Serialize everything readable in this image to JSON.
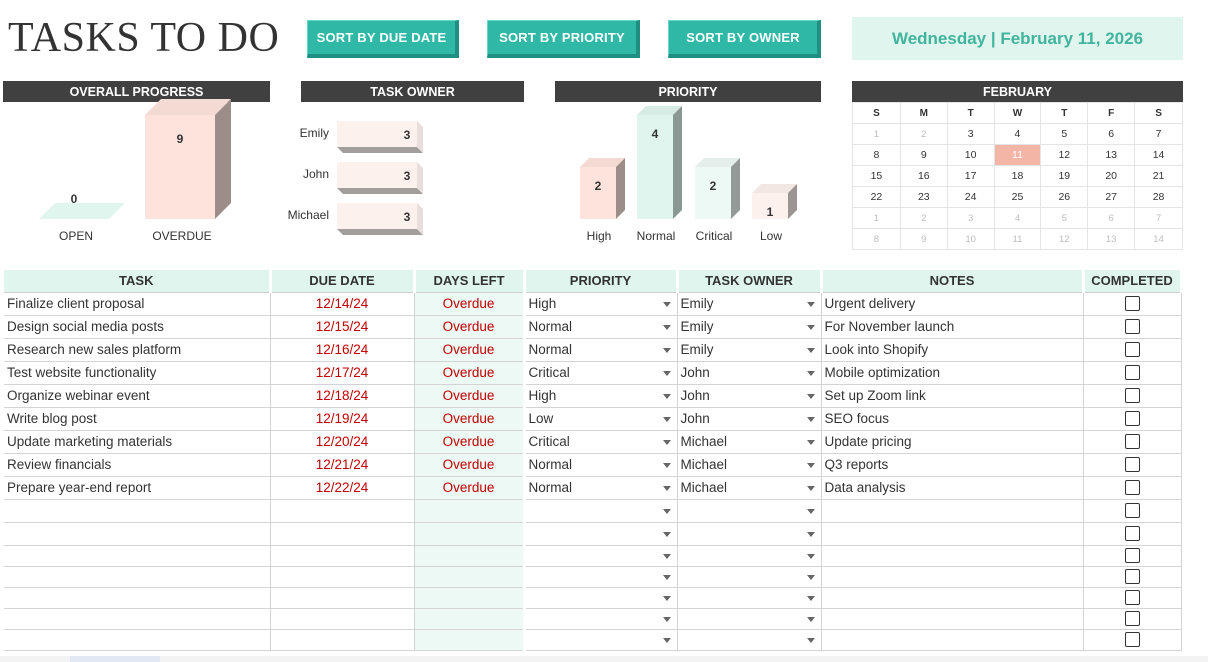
{
  "title": "TASKS TO DO",
  "sort_buttons": {
    "due": "SORT BY DUE DATE",
    "priority": "SORT BY PRIORITY",
    "owner": "SORT BY OWNER"
  },
  "date_text": "Wednesday | February 11, 2026",
  "panels": {
    "overall_progress": "OVERALL PROGRESS",
    "task_owner": "TASK OWNER",
    "priority": "PRIORITY",
    "month": "FEBRUARY"
  },
  "chart_data": [
    {
      "type": "bar",
      "title": "OVERALL PROGRESS",
      "categories": [
        "OPEN",
        "OVERDUE"
      ],
      "values": [
        0,
        9
      ],
      "ylim": [
        0,
        9
      ],
      "colors": [
        "#dff5ee",
        "#fde3dc"
      ]
    },
    {
      "type": "bar",
      "orientation": "horizontal",
      "title": "TASK OWNER",
      "categories": [
        "Emily",
        "John",
        "Michael"
      ],
      "values": [
        3,
        3,
        3
      ],
      "xlim": [
        0,
        3
      ],
      "colors": [
        "#fdf1ee",
        "#fdf1ee",
        "#fdf1ee"
      ]
    },
    {
      "type": "bar",
      "title": "PRIORITY",
      "categories": [
        "High",
        "Normal",
        "Critical",
        "Low"
      ],
      "values": [
        2,
        4,
        2,
        1
      ],
      "ylim": [
        0,
        4
      ],
      "colors": [
        "#fde3dc",
        "#dff5ee",
        "#edf9f5",
        "#fdf1ee"
      ]
    }
  ],
  "calendar": {
    "dows": [
      "S",
      "M",
      "T",
      "W",
      "T",
      "F",
      "S"
    ],
    "weeks": [
      [
        {
          "d": "1",
          "dim": true
        },
        {
          "d": "2",
          "dim": true
        },
        {
          "d": "3"
        },
        {
          "d": "4"
        },
        {
          "d": "5"
        },
        {
          "d": "6"
        },
        {
          "d": "7"
        }
      ],
      [
        {
          "d": "8"
        },
        {
          "d": "9"
        },
        {
          "d": "10"
        },
        {
          "d": "11",
          "today": true
        },
        {
          "d": "12"
        },
        {
          "d": "13"
        },
        {
          "d": "14"
        }
      ],
      [
        {
          "d": "15"
        },
        {
          "d": "16"
        },
        {
          "d": "17"
        },
        {
          "d": "18"
        },
        {
          "d": "19"
        },
        {
          "d": "20"
        },
        {
          "d": "21"
        }
      ],
      [
        {
          "d": "22"
        },
        {
          "d": "23"
        },
        {
          "d": "24"
        },
        {
          "d": "25"
        },
        {
          "d": "26"
        },
        {
          "d": "27"
        },
        {
          "d": "28"
        }
      ],
      [
        {
          "d": "1",
          "dim": true
        },
        {
          "d": "2",
          "dim": true
        },
        {
          "d": "3",
          "dim": true
        },
        {
          "d": "4",
          "dim": true
        },
        {
          "d": "5",
          "dim": true
        },
        {
          "d": "6",
          "dim": true
        },
        {
          "d": "7",
          "dim": true
        }
      ],
      [
        {
          "d": "8",
          "dim": true
        },
        {
          "d": "9",
          "dim": true
        },
        {
          "d": "10",
          "dim": true
        },
        {
          "d": "11",
          "dim": true
        },
        {
          "d": "12",
          "dim": true
        },
        {
          "d": "13",
          "dim": true
        },
        {
          "d": "14",
          "dim": true
        }
      ]
    ]
  },
  "table": {
    "headers": [
      "TASK",
      "DUE DATE",
      "DAYS LEFT",
      "PRIORITY",
      "TASK OWNER",
      "NOTES",
      "COMPLETED"
    ],
    "rows": [
      {
        "task": "Finalize client proposal",
        "due": "12/14/24",
        "days_left": "Overdue",
        "priority": "High",
        "owner": "Emily",
        "notes": "Urgent delivery",
        "completed": false
      },
      {
        "task": "Design social media posts",
        "due": "12/15/24",
        "days_left": "Overdue",
        "priority": "Normal",
        "owner": "Emily",
        "notes": "For November launch",
        "completed": false
      },
      {
        "task": "Research new sales platform",
        "due": "12/16/24",
        "days_left": "Overdue",
        "priority": "Normal",
        "owner": "Emily",
        "notes": "Look into Shopify",
        "completed": false
      },
      {
        "task": "Test website functionality",
        "due": "12/17/24",
        "days_left": "Overdue",
        "priority": "Critical",
        "owner": "John",
        "notes": "Mobile optimization",
        "completed": false
      },
      {
        "task": "Organize webinar event",
        "due": "12/18/24",
        "days_left": "Overdue",
        "priority": "High",
        "owner": "John",
        "notes": "Set up Zoom link",
        "completed": false
      },
      {
        "task": "Write blog post",
        "due": "12/19/24",
        "days_left": "Overdue",
        "priority": "Low",
        "owner": "John",
        "notes": "SEO focus",
        "completed": false
      },
      {
        "task": "Update marketing materials",
        "due": "12/20/24",
        "days_left": "Overdue",
        "priority": "Critical",
        "owner": "Michael",
        "notes": "Update pricing",
        "completed": false
      },
      {
        "task": "Review financials",
        "due": "12/21/24",
        "days_left": "Overdue",
        "priority": "Normal",
        "owner": "Michael",
        "notes": "Q3 reports",
        "completed": false
      },
      {
        "task": "Prepare year-end report",
        "due": "12/22/24",
        "days_left": "Overdue",
        "priority": "Normal",
        "owner": "Michael",
        "notes": "Data analysis",
        "completed": false
      },
      {
        "task": "",
        "due": "",
        "days_left": "",
        "priority": "",
        "owner": "",
        "notes": "",
        "completed": false
      },
      {
        "task": "",
        "due": "",
        "days_left": "",
        "priority": "",
        "owner": "",
        "notes": "",
        "completed": false
      },
      {
        "task": "",
        "due": "",
        "days_left": "",
        "priority": "",
        "owner": "",
        "notes": "",
        "completed": false
      },
      {
        "task": "",
        "due": "",
        "days_left": "",
        "priority": "",
        "owner": "",
        "notes": "",
        "completed": false
      },
      {
        "task": "",
        "due": "",
        "days_left": "",
        "priority": "",
        "owner": "",
        "notes": "",
        "completed": false
      },
      {
        "task": "",
        "due": "",
        "days_left": "",
        "priority": "",
        "owner": "",
        "notes": "",
        "completed": false
      },
      {
        "task": "",
        "due": "",
        "days_left": "",
        "priority": "",
        "owner": "",
        "notes": "",
        "completed": false
      }
    ]
  }
}
